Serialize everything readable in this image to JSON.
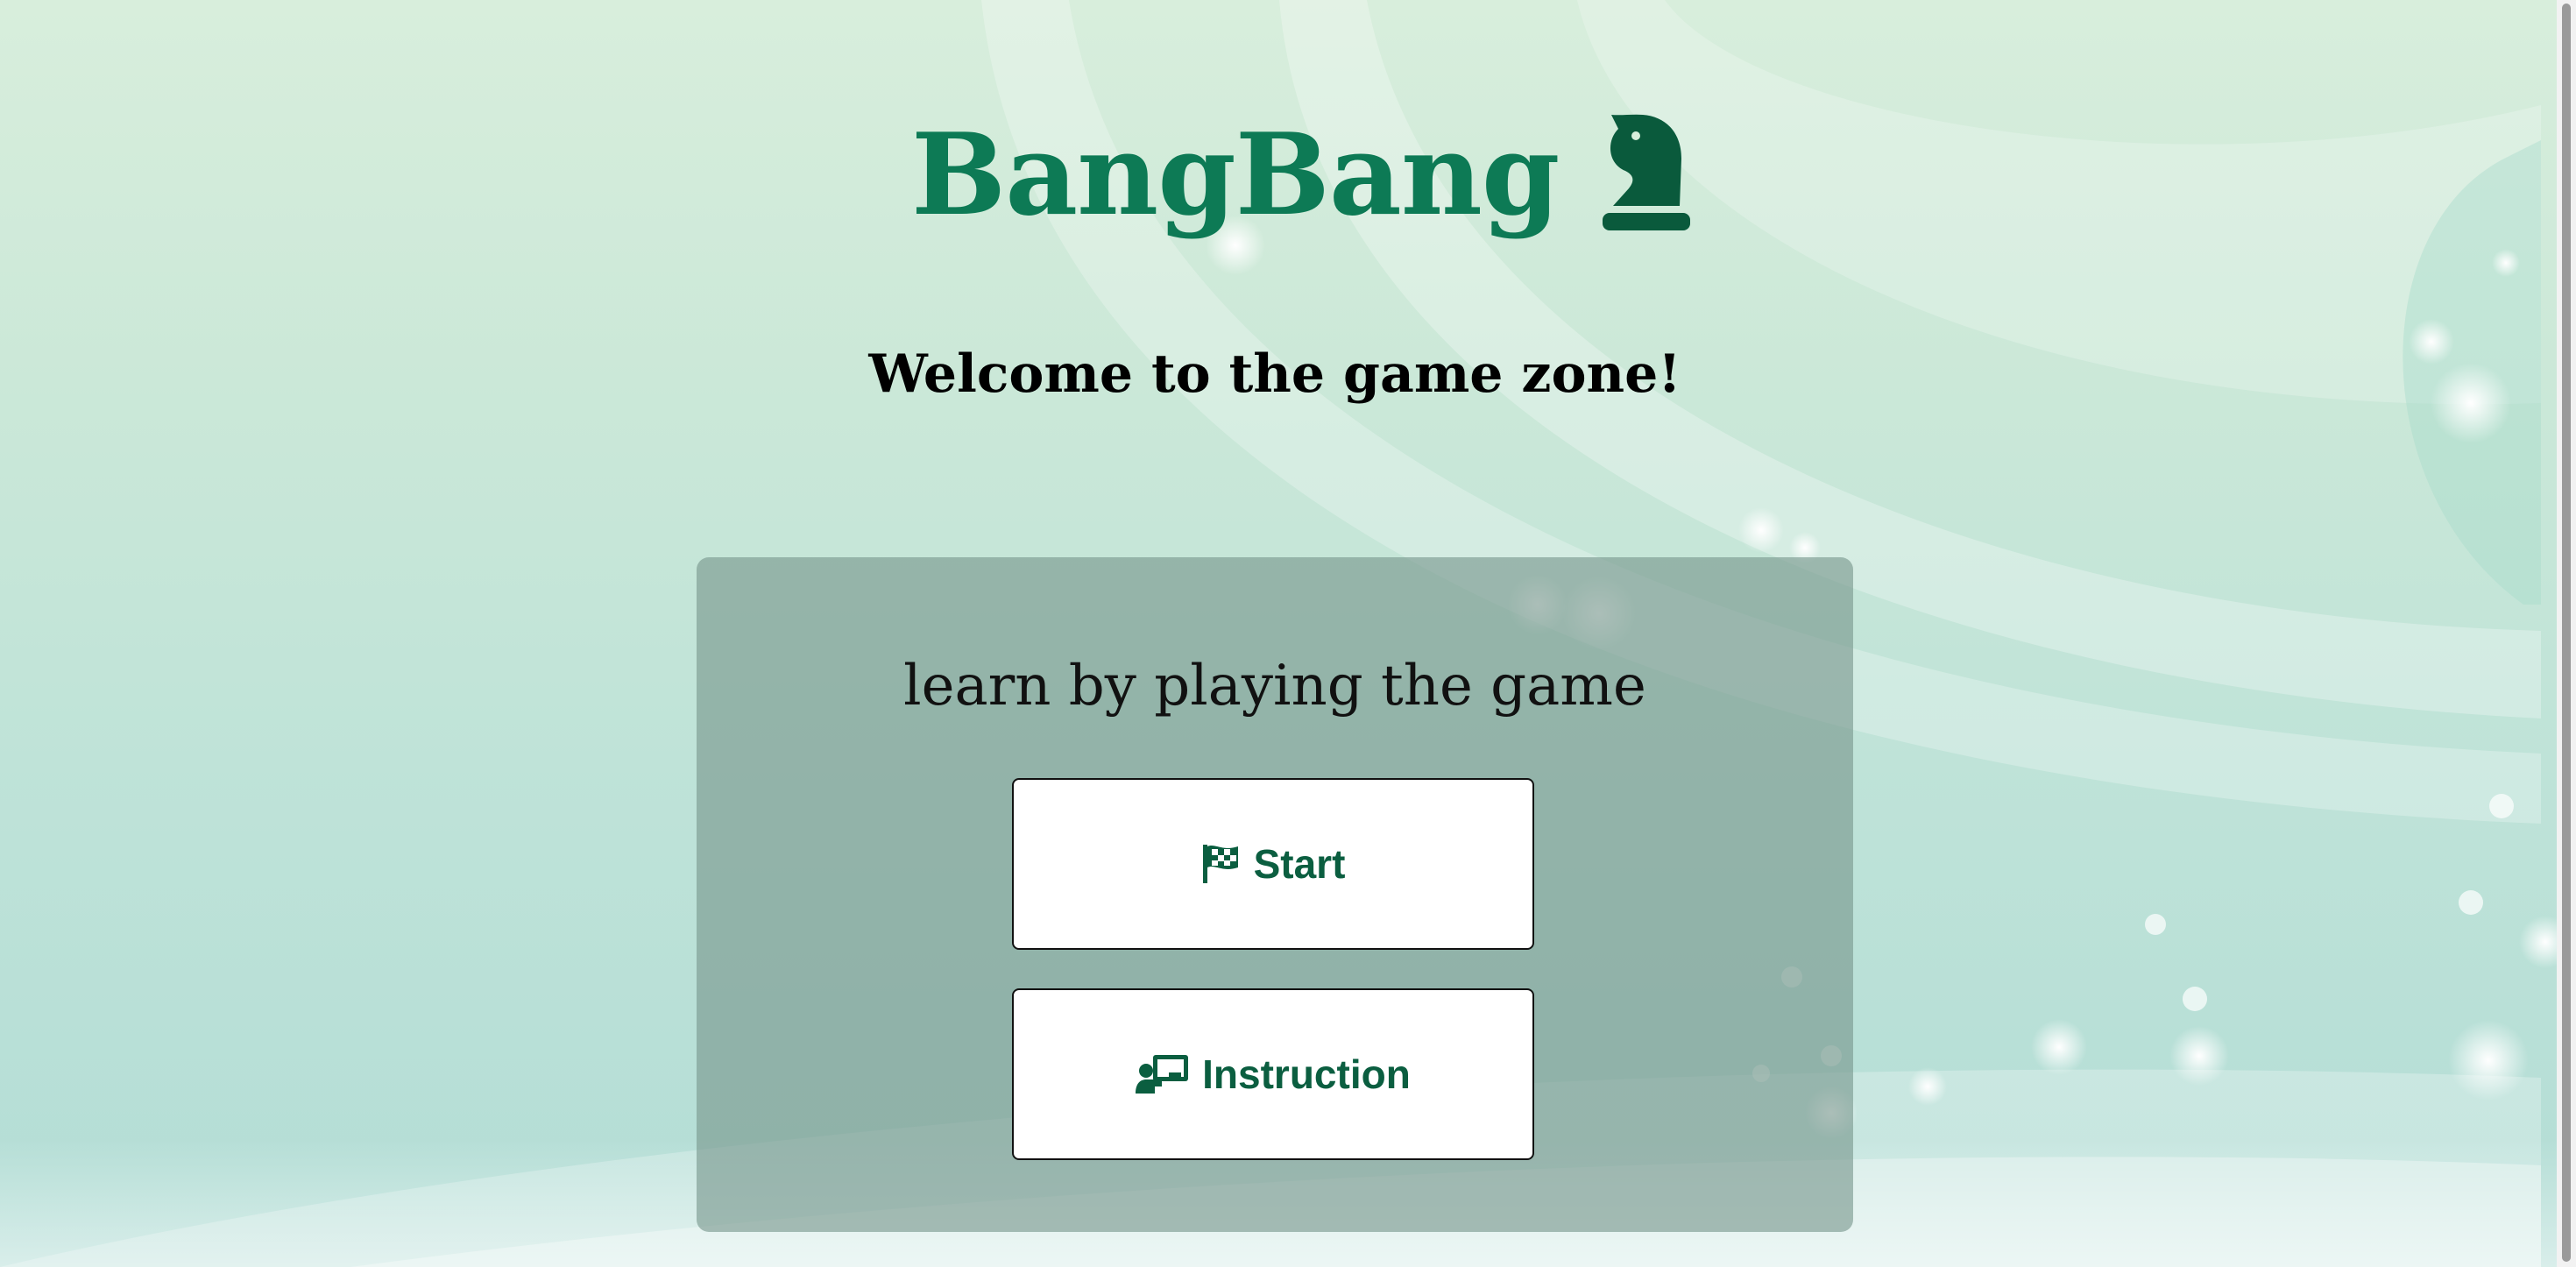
{
  "app": {
    "logo_text": "BangBang",
    "logo_icon": "chess-knight-icon"
  },
  "header": {
    "welcome": "Welcome to the game zone!"
  },
  "panel": {
    "tagline": "learn by playing the game",
    "start_label": "Start",
    "start_icon": "checkered-flag-icon",
    "instruction_label": "Instruction",
    "instruction_icon": "teacher-board-icon"
  },
  "colors": {
    "brand": "#0d7a55",
    "button_text": "#0b5e40"
  }
}
